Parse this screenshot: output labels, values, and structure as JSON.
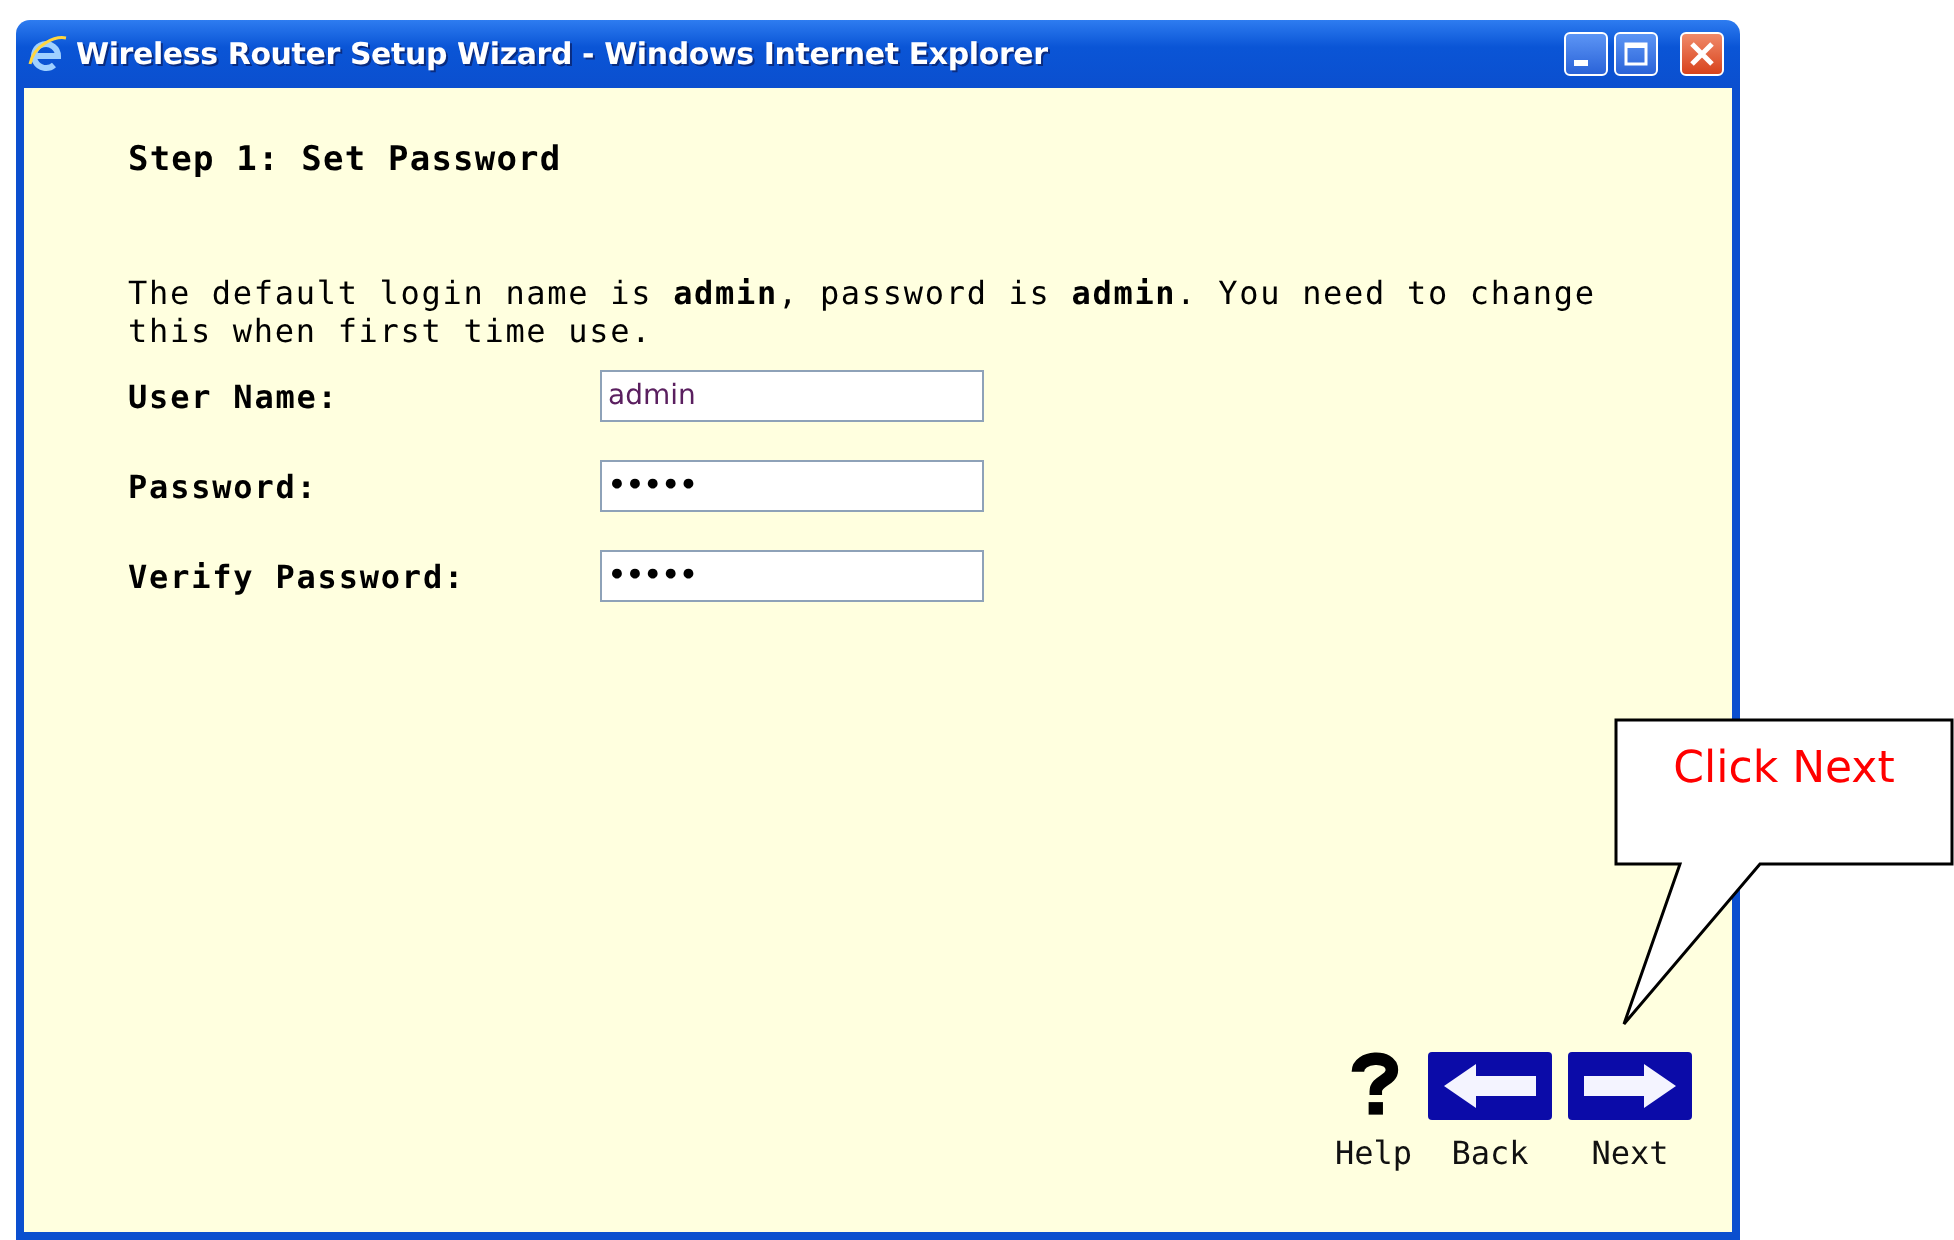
{
  "window": {
    "title": "Wireless Router Setup Wizard - Windows Internet Explorer",
    "controls": [
      {
        "kind": "minimize"
      },
      {
        "kind": "maximize"
      },
      {
        "kind": "close"
      }
    ]
  },
  "step_title": "Step 1: Set Password",
  "intro": "The default login name is **admin**, password is **admin**. You need to change this when first time use.",
  "fields": [
    {
      "label": "User Name:",
      "value": "admin",
      "kind": "text"
    },
    {
      "label": "Password:",
      "value": "•••••",
      "kind": "password"
    },
    {
      "label": "Verify Password:",
      "value": "•••••",
      "kind": "password"
    }
  ],
  "nav": [
    {
      "kind": "help",
      "label": "Help"
    },
    {
      "kind": "back",
      "label": "Back"
    },
    {
      "kind": "next",
      "label": "Next"
    }
  ],
  "callout": {
    "text": "Click Next"
  }
}
